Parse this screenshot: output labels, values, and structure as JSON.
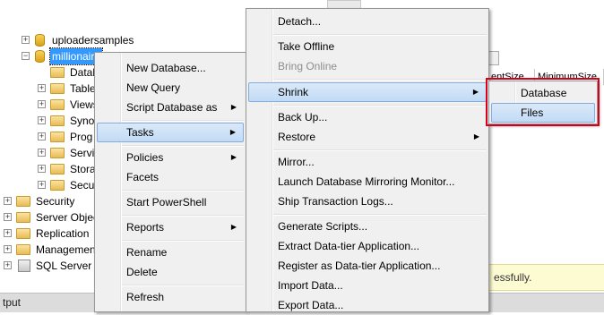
{
  "tree": {
    "databases": [
      {
        "label": "uploadersamples"
      },
      {
        "label": "millionaire"
      }
    ],
    "folders": [
      "Datab",
      "Table",
      "Views",
      "Syno",
      "Prog",
      "Servi",
      "Stora",
      "Secu"
    ],
    "server_nodes": [
      "Security",
      "Server Object",
      "Replication",
      "Managemen",
      "SQL Server A"
    ]
  },
  "grid": {
    "columns": [
      "entSize",
      "MinimumSize"
    ]
  },
  "status_message": "essfully.",
  "output_panel_title": "tput",
  "menu1": {
    "items": [
      {
        "label": "New Database..."
      },
      {
        "label": "New Query"
      },
      {
        "label": "Script Database as",
        "submenu": true
      },
      {
        "label": "Tasks",
        "submenu": true,
        "highlighted": true
      },
      {
        "label": "Policies",
        "submenu": true
      },
      {
        "label": "Facets"
      },
      {
        "label": "Start PowerShell"
      },
      {
        "label": "Reports",
        "submenu": true
      },
      {
        "label": "Rename"
      },
      {
        "label": "Delete"
      },
      {
        "label": "Refresh"
      }
    ]
  },
  "menu2": {
    "items": [
      {
        "label": "Detach..."
      },
      {
        "label": "Take Offline"
      },
      {
        "label": "Bring Online",
        "disabled": true
      },
      {
        "label": "Shrink",
        "submenu": true,
        "highlighted": true
      },
      {
        "label": "Back Up..."
      },
      {
        "label": "Restore",
        "submenu": true
      },
      {
        "label": "Mirror..."
      },
      {
        "label": "Launch Database Mirroring Monitor..."
      },
      {
        "label": "Ship Transaction Logs..."
      },
      {
        "label": "Generate Scripts..."
      },
      {
        "label": "Extract Data-tier Application..."
      },
      {
        "label": "Register as Data-tier Application..."
      },
      {
        "label": "Import Data..."
      },
      {
        "label": "Export Data..."
      }
    ]
  },
  "menu3": {
    "items": [
      {
        "label": "Database"
      },
      {
        "label": "Files",
        "highlighted": true
      }
    ]
  },
  "colors": {
    "highlight_border": "#84acdd",
    "callout_red": "#d6001c",
    "selection_blue": "#3399ff"
  }
}
